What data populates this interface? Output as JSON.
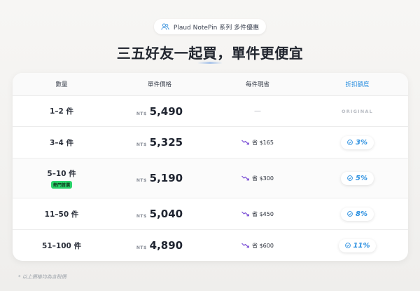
{
  "header": {
    "pill_text": "Plaud NotePin 系列 多件優惠",
    "pill_icon": "users-icon",
    "headline": "三五好友一起買，單件更便宜"
  },
  "table": {
    "columns": [
      "數量",
      "單件價格",
      "每件現省",
      "折扣額度"
    ],
    "currency": "NT$",
    "rows": [
      {
        "quantity": "1–2 件",
        "price": "5,490",
        "savings": "—",
        "discount": "ORIGINAL"
      },
      {
        "quantity": "3–4 件",
        "price": "5,325",
        "savings": "省 $165",
        "discount": "3%"
      },
      {
        "quantity": "5–10 件",
        "tag": "熱門首選",
        "price": "5,190",
        "savings": "省 $300",
        "discount": "5%"
      },
      {
        "quantity": "11–50 件",
        "price": "5,040",
        "savings": "省 $450",
        "discount": "8%"
      },
      {
        "quantity": "51–100 件",
        "price": "4,890",
        "savings": "省 $600",
        "discount": "11%"
      }
    ]
  },
  "footnote": "* 以上價格均為含稅價",
  "colors": {
    "accent_blue": "#2a8fe0",
    "highlight_green": "#2bd36b",
    "trend_purple": "#7b4fd6"
  }
}
